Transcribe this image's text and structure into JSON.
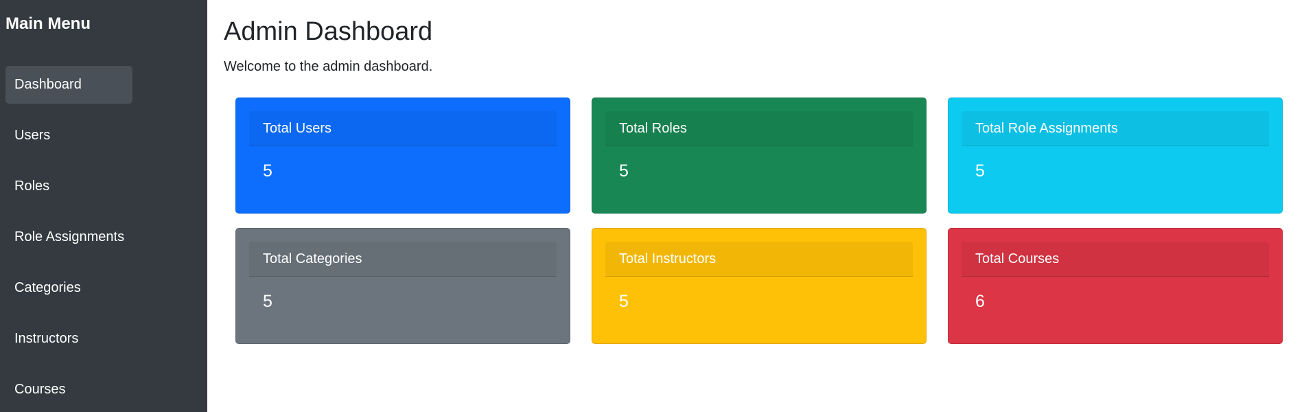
{
  "sidebar": {
    "title": "Main Menu",
    "items": [
      {
        "label": "Dashboard",
        "active": true
      },
      {
        "label": "Users",
        "active": false
      },
      {
        "label": "Roles",
        "active": false
      },
      {
        "label": "Role Assignments",
        "active": false
      },
      {
        "label": "Categories",
        "active": false
      },
      {
        "label": "Instructors",
        "active": false
      },
      {
        "label": "Courses",
        "active": false
      }
    ],
    "background": "#343a40",
    "active_background": "#495057"
  },
  "main": {
    "title": "Admin Dashboard",
    "subtitle": "Welcome to the admin dashboard.",
    "cards": [
      {
        "label": "Total Users",
        "value": "5",
        "color": "#0d6efd"
      },
      {
        "label": "Total Roles",
        "value": "5",
        "color": "#198754"
      },
      {
        "label": "Total Role Assignments",
        "value": "5",
        "color": "#0dcaf0"
      },
      {
        "label": "Total Categories",
        "value": "5",
        "color": "#6c757d"
      },
      {
        "label": "Total Instructors",
        "value": "5",
        "color": "#ffc107"
      },
      {
        "label": "Total Courses",
        "value": "6",
        "color": "#dc3545"
      }
    ]
  }
}
